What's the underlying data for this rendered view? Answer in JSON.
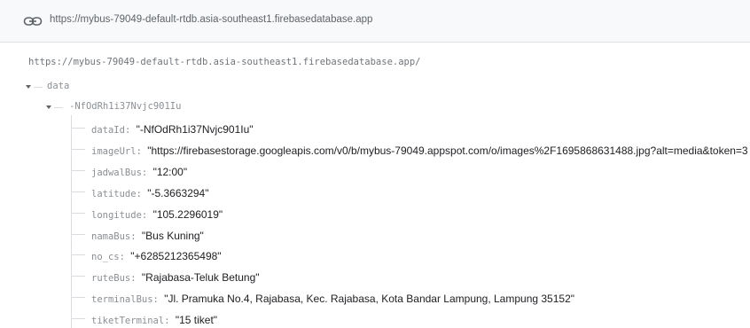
{
  "header": {
    "url": "https://mybus-79049-default-rtdb.asia-southeast1.firebasedatabase.app"
  },
  "tree": {
    "root_url": "https://mybus-79049-default-rtdb.asia-southeast1.firebasedatabase.app/",
    "data_key": "data",
    "record_key": "-NfOdRh1i37Nvjc901Iu",
    "fields": [
      {
        "key": "dataId",
        "value": "\"-NfOdRh1i37Nvjc901Iu\""
      },
      {
        "key": "imageUrl",
        "value": "\"https://firebasestorage.googleapis.com/v0/b/mybus-79049.appspot.com/o/images%2F1695868631488.jpg?alt=media&token=3"
      },
      {
        "key": "jadwalBus",
        "value": "\"12:00\""
      },
      {
        "key": "latitude",
        "value": "\"-5.3663294\""
      },
      {
        "key": "longitude",
        "value": "\"105.2296019\""
      },
      {
        "key": "namaBus",
        "value": "\"Bus Kuning\""
      },
      {
        "key": "no_cs",
        "value": "\"+6285212365498\""
      },
      {
        "key": "ruteBus",
        "value": "\"Rajabasa-Teluk Betung\""
      },
      {
        "key": "terminalBus",
        "value": "\"Jl. Pramuka No.4, Rajabasa, Kec. Rajabasa, Kota Bandar Lampung, Lampung 35152\""
      },
      {
        "key": "tiketTerminal",
        "value": "\"15 tiket\""
      }
    ]
  }
}
